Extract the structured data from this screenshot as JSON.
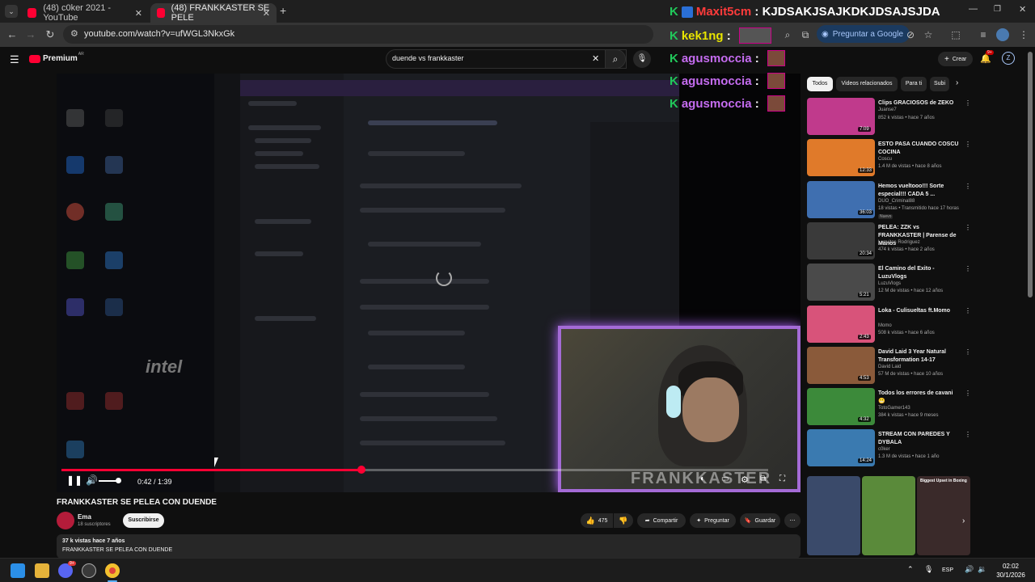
{
  "browser": {
    "tabs": [
      {
        "label": "(48) c0ker 2021 - YouTube",
        "active": false
      },
      {
        "label": "(48) FRANKKASTER SE PELE",
        "active": true
      }
    ],
    "new_tab": "+",
    "url": "youtube.com/watch?v=ufWGL3NkxGk",
    "google_button": "Preguntar a Google"
  },
  "youtube": {
    "logo": "Premium",
    "logo_region": "AR",
    "search_query": "duende vs frankkaster",
    "create_label": "Crear",
    "notif_count": "9+",
    "profile_initial": "Z"
  },
  "player": {
    "time": "0:42 / 1:39",
    "progress": 0.424,
    "webcam_watermark": "FRANKKASTER",
    "desktop_label": "intel"
  },
  "overlay": {
    "lines": [
      {
        "user": "Maxit5cm",
        "message": "KJDSAKJSAJKDKJDSAJSJDA",
        "color": "#ff3b3b"
      },
      {
        "user": "kek1ng",
        "message": "",
        "color": "#e8e400"
      },
      {
        "user": "agusmoccia",
        "message": "",
        "color": "#c56cf0"
      },
      {
        "user": "agusmoccia",
        "message": "",
        "color": "#c56cf0"
      },
      {
        "user": "agusmoccia",
        "message": "",
        "color": "#c56cf0"
      }
    ]
  },
  "video": {
    "title": "FRANKKASTER SE PELEA CON DUENDE",
    "channel": "Ema",
    "subscribers": "18 suscriptores",
    "subscribe_label": "Suscribirse",
    "likes": "475",
    "share_label": "Compartir",
    "ask_label": "Preguntar",
    "save_label": "Guardar",
    "views_line": "37 k vistas  hace 7 años",
    "desc_line": "FRANKKASTER SE PELEA CON DUENDE"
  },
  "chips": [
    "Todos",
    "Videos relacionados",
    "Para ti",
    "Subi"
  ],
  "recommendations": [
    {
      "title": "Clips GRACIOSOS de ZEKO",
      "channel": "Juanse7",
      "meta": "852 k vistas • hace 7 años",
      "duration": "7:09",
      "thumb_color": "#c03a8c"
    },
    {
      "title": "ESTO PASA CUANDO COSCU COCINA",
      "channel": "Coscu",
      "meta": "1.4 M de vistas • hace 8 años",
      "duration": "12:33",
      "thumb_color": "#e07a2a"
    },
    {
      "title": "Hemos vueltooo!!! Sorte especial!!! CADA 5 ...",
      "channel": "DUO_Criminal88",
      "meta": "18 vistas • Transmitido hace 17 horas",
      "duration": "36:03",
      "thumb_color": "#3f6fb0",
      "badge": "Nuevo"
    },
    {
      "title": "PELEA: ZZK vs FRANKKASTER | Parense de Manos",
      "channel": "Luquitas Rodriguez",
      "meta": "474 k vistas • hace 2 años",
      "duration": "20:34",
      "thumb_color": "#3a3a3a"
    },
    {
      "title": "El Camino del Exito - LuzuVlogs",
      "channel": "LuzuVlogs",
      "meta": "12 M de vistas • hace 12 años",
      "duration": "5:21",
      "thumb_color": "#4a4a4a"
    },
    {
      "title": "Loka - Culisueltas ft.Momo",
      "channel": "Momo",
      "meta": "508 k vistas • hace 6 años",
      "duration": "2:43",
      "thumb_color": "#d8537a"
    },
    {
      "title": "David Laid 3 Year Natural Transformation 14-17",
      "channel": "David Laid",
      "meta": "57 M de vistas • hace 10 años",
      "duration": "4:53",
      "thumb_color": "#8a5a3a"
    },
    {
      "title": "Todos los errores de cavani 😬",
      "channel": "TotoGamer143",
      "meta": "384 k vistas • hace 9 meses",
      "duration": "4:32",
      "thumb_color": "#3c8a3a"
    },
    {
      "title": "STREAM CON PAREDES Y DYBALA",
      "channel": "c0ker",
      "meta": "1.3 M de vistas • hace 1 año",
      "duration": "14:24",
      "thumb_color": "#3a7ab0"
    }
  ],
  "shorts": [
    {
      "title": "",
      "color": "#3a4a6a"
    },
    {
      "title": "",
      "color": "#5a8a3a"
    },
    {
      "title": "Biggest Upset in Boxing",
      "color": "#3a2a2a"
    }
  ],
  "taskbar": {
    "lang": "ESP",
    "time": "02:02",
    "date": "30/1/2026",
    "discord_badge": "9+"
  }
}
